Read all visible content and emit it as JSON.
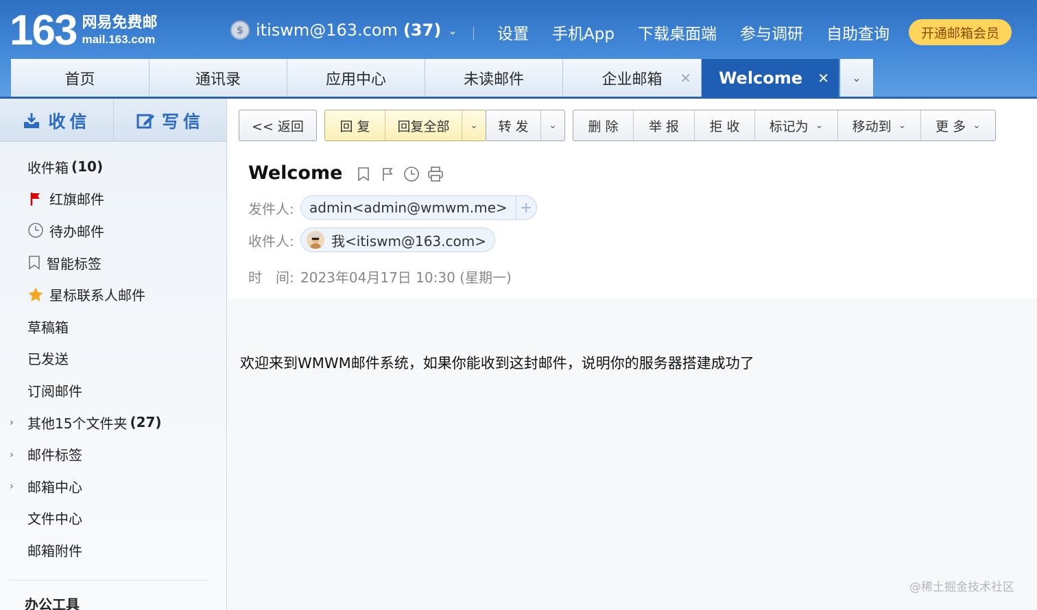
{
  "brand": {
    "number": "163",
    "cn": "网易免费邮",
    "en": "mail.163.com"
  },
  "account": {
    "email": "itiswm@163.com",
    "count": "(37)"
  },
  "top_links": [
    "设置",
    "手机App",
    "下载桌面端",
    "参与调研",
    "自助查询"
  ],
  "vip_label": "开通邮箱会员",
  "tabs": [
    {
      "label": "首页"
    },
    {
      "label": "通讯录"
    },
    {
      "label": "应用中心"
    },
    {
      "label": "未读邮件"
    },
    {
      "label": "企业邮箱"
    },
    {
      "label": "Welcome"
    }
  ],
  "compose": {
    "receive": "收信",
    "write": "写信"
  },
  "folders": {
    "inbox": "收件箱",
    "inbox_count": "(10)",
    "flagged": "红旗邮件",
    "todo": "待办邮件",
    "smart_tags": "智能标签",
    "star_contacts": "星标联系人邮件",
    "drafts": "草稿箱",
    "sent": "已发送",
    "subscriptions": "订阅邮件",
    "other_folders": "其他15个文件夹",
    "other_count": "(27)",
    "mail_tags": "邮件标签",
    "mail_center": "邮箱中心",
    "file_center": "文件中心",
    "attachments": "邮箱附件",
    "office_tools": "办公工具"
  },
  "toolbar": {
    "back": "<< 返回",
    "reply": "回 复",
    "reply_all": "回复全部",
    "forward": "转 发",
    "delete": "删 除",
    "report": "举 报",
    "reject": "拒 收",
    "mark_as": "标记为",
    "move_to": "移动到",
    "more": "更 多"
  },
  "mail": {
    "subject": "Welcome",
    "from_label": "发件人:",
    "from": "admin<admin@wmwm.me>",
    "to_label": "收件人:",
    "to": "我<itiswm@163.com>",
    "time_label": "时　间:",
    "time": "2023年04月17日 10:30 (星期一)",
    "body": "欢迎来到WMWM邮件系统，如果你能收到这封邮件，说明你的服务器搭建成功了"
  },
  "watermark": "@稀土掘金技术社区"
}
